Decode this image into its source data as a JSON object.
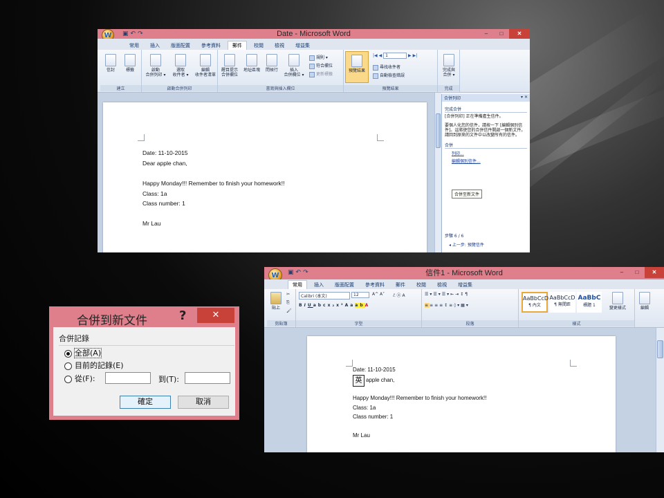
{
  "window_top": {
    "title": "Date - Microsoft Word",
    "tabs": [
      "常用",
      "插入",
      "版面配置",
      "參考資料",
      "郵件",
      "校閱",
      "檢視",
      "增益集"
    ],
    "active_tab": "郵件",
    "groups": [
      "建立",
      "啟動合併列印",
      "書寫與插入欄位",
      "預覽結果",
      "完成"
    ],
    "buttons": {
      "envelopes": "信封",
      "labels": "標籤",
      "start_merge": "啟動",
      "start_merge_sub": "合併列印 ▾",
      "select_recipients": "選取",
      "select_recipients_sub": "收件者 ▾",
      "edit_list": "編輯",
      "edit_list_sub": "收件者清單",
      "highlight": "醒目提示",
      "highlight_sub": "合併欄位",
      "address_block": "地址區塊",
      "greeting": "問候行",
      "insert_field": "插入",
      "insert_field_sub": "合併欄位 ▾",
      "rules": "規則 ▾",
      "match_fields": "符合欄位",
      "update_labels": "更新標籤",
      "preview": "預覽結果",
      "record_number": "1",
      "find_recipient": "尋找收件者",
      "auto_check": "自動檢查錯誤",
      "finish_merge": "完成與",
      "finish_merge_sub": "合併 ▾"
    },
    "doc_lines": [
      "Date: 11-10-2015",
      "Dear apple chan,",
      "",
      "Happy Monday!!! Remember to finish your homework!!",
      "Class: 1a",
      "Class number: 1",
      "",
      "Mr Lau"
    ],
    "pane": {
      "title": "合併列印",
      "section1": "完成合併",
      "text1": "[合併列印] 正在準備產生信件。",
      "text2": "要個人化您的信件，請按一下 [編輯個別信件]。這將使您的合併信件開啟一個新文件。請回到原來的文件中以改變所有的信件。",
      "section2": "合併",
      "link_print": "列印...",
      "link_edit": "編輯個別信件...",
      "tooltip": "合併至新文件",
      "step": "步驟 6 / 6",
      "prev": "上一步: 預覽信件"
    }
  },
  "window_bottom": {
    "title": "信件1 - Microsoft Word",
    "tabs": [
      "常用",
      "插入",
      "版面配置",
      "參考資料",
      "郵件",
      "校閱",
      "檢視",
      "增益集"
    ],
    "active_tab": "常用",
    "groups": [
      "剪貼簿",
      "字型",
      "段落",
      "樣式"
    ],
    "font_name": "Calibri (本文)",
    "font_size": "12",
    "paste_label": "貼上",
    "styles": [
      {
        "sample": "AaBbCcD",
        "name": "¶ 內文"
      },
      {
        "sample": "AaBbCcD",
        "name": "¶ 無間距"
      },
      {
        "sample": "AaBbC",
        "name": "標題 1"
      }
    ],
    "change_styles": "變更樣式",
    "edit_label": "編輯",
    "ime_char": "英",
    "doc_lines": [
      "Date: 11-10-2015",
      "apple chan,",
      "",
      "Happy Monday!!! Remember to finish your homework!!",
      "Class: 1a",
      "Class number: 1",
      "",
      "Mr Lau"
    ]
  },
  "dialog": {
    "title": "合併到新文件",
    "help": "?",
    "close": "✕",
    "group_label": "合併記錄",
    "options": [
      "全部(A)",
      "目前的記錄(E)",
      "從(F):"
    ],
    "selected": "全部(A)",
    "to_label": "到(T):",
    "ok": "確定",
    "cancel": "取消"
  },
  "colors": {
    "titlebar": "#de7f8b",
    "close_button": "#c9423a",
    "ribbon_accent": "#173a6b"
  }
}
